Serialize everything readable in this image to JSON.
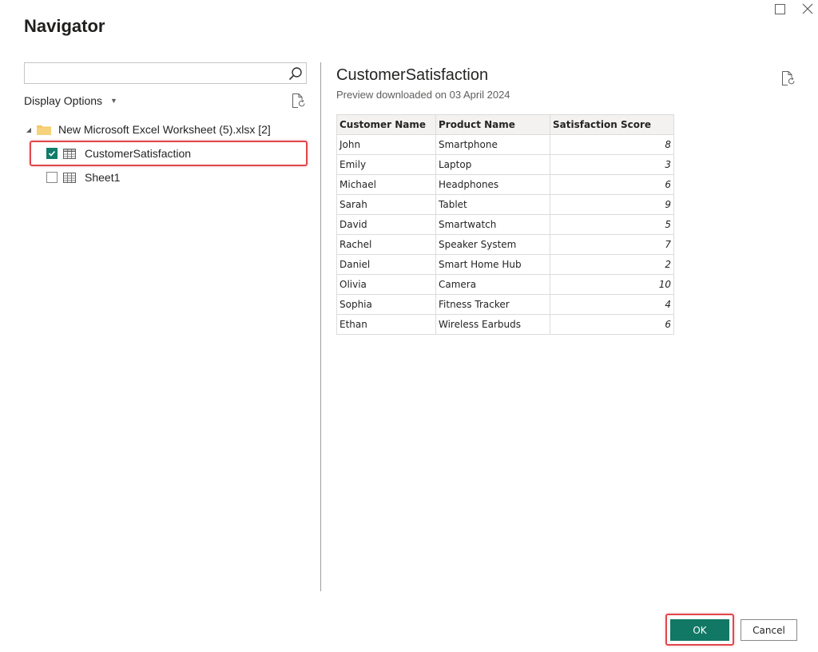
{
  "window": {
    "title": "Navigator",
    "maximize_icon": "maximize-icon",
    "close_icon": "close-icon"
  },
  "left_panel": {
    "search": {
      "value": "",
      "placeholder": ""
    },
    "display_options_label": "Display Options",
    "tree": {
      "file": {
        "label": "New Microsoft Excel Worksheet (5).xlsx [2]",
        "icon": "folder-icon",
        "expanded": true
      },
      "items": [
        {
          "label": "CustomerSatisfaction",
          "checked": true,
          "icon": "table-icon",
          "highlighted": true
        },
        {
          "label": "Sheet1",
          "checked": false,
          "icon": "sheet-icon",
          "highlighted": false
        }
      ]
    }
  },
  "preview": {
    "title": "CustomerSatisfaction",
    "subtitle": "Preview downloaded on 03 April 2024",
    "columns": [
      "Customer Name",
      "Product Name",
      "Satisfaction Score"
    ],
    "rows": [
      [
        "John",
        "Smartphone",
        "8"
      ],
      [
        "Emily",
        "Laptop",
        "3"
      ],
      [
        "Michael",
        "Headphones",
        "6"
      ],
      [
        "Sarah",
        "Tablet",
        "9"
      ],
      [
        "David",
        "Smartwatch",
        "5"
      ],
      [
        "Rachel",
        "Speaker System",
        "7"
      ],
      [
        "Daniel",
        "Smart Home Hub",
        "2"
      ],
      [
        "Olivia",
        "Camera",
        "10"
      ],
      [
        "Sophia",
        "Fitness Tracker",
        "4"
      ],
      [
        "Ethan",
        "Wireless Earbuds",
        "6"
      ]
    ]
  },
  "footer": {
    "ok_label": "OK",
    "cancel_label": "Cancel"
  },
  "colors": {
    "accent": "#117865",
    "highlight": "#e0474c",
    "folder": "#f2c75c"
  }
}
